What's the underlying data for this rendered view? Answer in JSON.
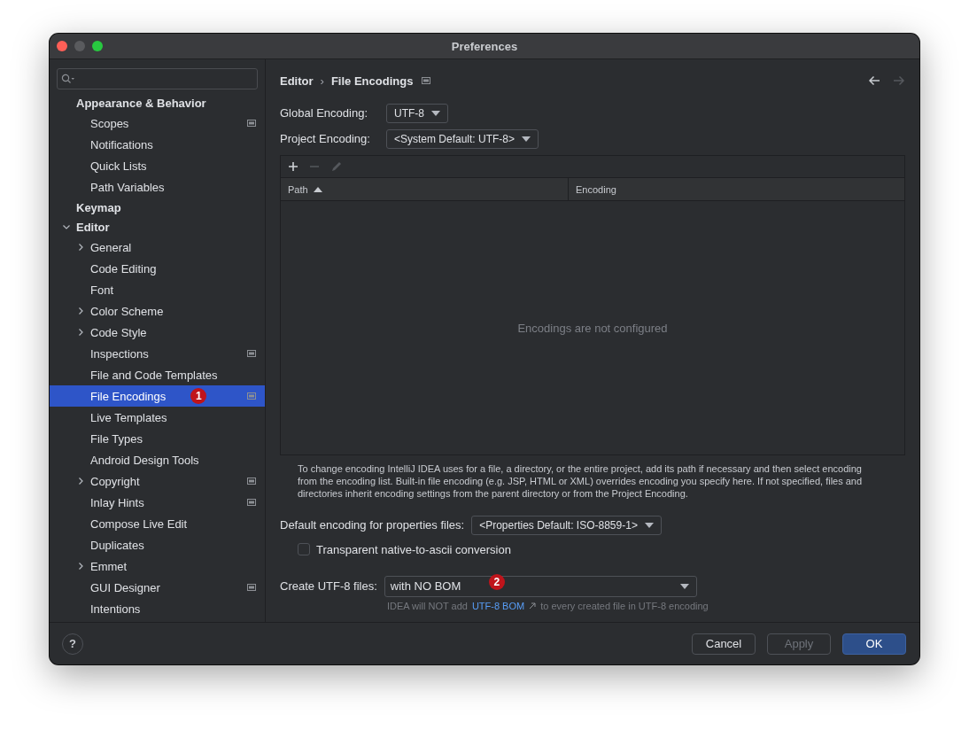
{
  "window": {
    "title": "Preferences"
  },
  "sidebar": {
    "tree": [
      {
        "label": "Appearance & Behavior",
        "kind": "group",
        "selected": false,
        "project_level": false,
        "children": [
          {
            "label": "Scopes",
            "kind": "item",
            "selected": false,
            "project_level": true
          },
          {
            "label": "Notifications",
            "kind": "item",
            "selected": false,
            "project_level": false
          },
          {
            "label": "Quick Lists",
            "kind": "item",
            "selected": false,
            "project_level": false
          },
          {
            "label": "Path Variables",
            "kind": "item",
            "selected": false,
            "project_level": false
          }
        ]
      },
      {
        "label": "Keymap",
        "kind": "group",
        "selected": false,
        "project_level": false
      },
      {
        "label": "Editor",
        "kind": "group",
        "selected": false,
        "project_level": false,
        "expanded": true,
        "children": [
          {
            "label": "General",
            "kind": "item",
            "selected": false,
            "project_level": false,
            "expanded": false
          },
          {
            "label": "Code Editing",
            "kind": "item",
            "selected": false,
            "project_level": false
          },
          {
            "label": "Font",
            "kind": "item",
            "selected": false,
            "project_level": false
          },
          {
            "label": "Color Scheme",
            "kind": "item",
            "selected": false,
            "project_level": false,
            "expanded": false
          },
          {
            "label": "Code Style",
            "kind": "item",
            "selected": false,
            "project_level": false,
            "expanded": false
          },
          {
            "label": "Inspections",
            "kind": "item",
            "selected": false,
            "project_level": true
          },
          {
            "label": "File and Code Templates",
            "kind": "item",
            "selected": false,
            "project_level": false
          },
          {
            "label": "File Encodings",
            "kind": "item",
            "selected": true,
            "project_level": true,
            "callout": "1"
          },
          {
            "label": "Live Templates",
            "kind": "item",
            "selected": false,
            "project_level": false
          },
          {
            "label": "File Types",
            "kind": "item",
            "selected": false,
            "project_level": false
          },
          {
            "label": "Android Design Tools",
            "kind": "item",
            "selected": false,
            "project_level": false
          },
          {
            "label": "Copyright",
            "kind": "item",
            "selected": false,
            "project_level": true,
            "expanded": false
          },
          {
            "label": "Inlay Hints",
            "kind": "item",
            "selected": false,
            "project_level": true
          },
          {
            "label": "Compose Live Edit",
            "kind": "item",
            "selected": false,
            "project_level": false
          },
          {
            "label": "Duplicates",
            "kind": "item",
            "selected": false,
            "project_level": false
          },
          {
            "label": "Emmet",
            "kind": "item",
            "selected": false,
            "project_level": false,
            "expanded": false
          },
          {
            "label": "GUI Designer",
            "kind": "item",
            "selected": false,
            "project_level": true
          },
          {
            "label": "Intentions",
            "kind": "item",
            "selected": false,
            "project_level": false
          }
        ]
      }
    ]
  },
  "breadcrumb": {
    "items": [
      "Editor",
      "File Encodings"
    ],
    "separator": "›",
    "project_level": true
  },
  "nav": [
    {
      "kind": "back",
      "disabled": false
    },
    {
      "kind": "forward",
      "disabled": true
    }
  ],
  "global_encoding": {
    "label": "Global Encoding:",
    "value": "UTF-8"
  },
  "project_encoding": {
    "label": "Project Encoding:",
    "value": "<System Default: UTF-8>"
  },
  "table": {
    "toolbar": [
      {
        "kind": "add",
        "disabled": false
      },
      {
        "kind": "remove",
        "disabled": true
      },
      {
        "kind": "edit",
        "disabled": true
      }
    ],
    "columns": [
      {
        "label": "Path",
        "sorted": true
      },
      {
        "label": "Encoding",
        "sorted": false
      }
    ],
    "empty_text": "Encodings are not configured"
  },
  "help_text": "To change encoding IntelliJ IDEA uses for a file, a directory, or the entire project, add its path if necessary and then select encoding from the encoding list. Built-in file encoding (e.g. JSP, HTML or XML) overrides encoding you specify here. If not specified, files and directories inherit encoding settings from the parent directory or from the Project Encoding.",
  "properties_encoding": {
    "label": "Default encoding for properties files:",
    "value": "<Properties Default: ISO-8859-1>"
  },
  "transparent_conversion": {
    "label": "Transparent native-to-ascii conversion",
    "checked": false
  },
  "create_utf8": {
    "label": "Create UTF-8 files:",
    "value": "with NO BOM",
    "callout": "2"
  },
  "bom_hint": {
    "before": "IDEA will NOT add",
    "link": "UTF-8 BOM",
    "after": "to every created file in UTF-8 encoding"
  },
  "help": "?",
  "buttons": [
    {
      "label": "Cancel",
      "kind": "normal",
      "disabled": false
    },
    {
      "label": "Apply",
      "kind": "normal",
      "disabled": true
    },
    {
      "label": "OK",
      "kind": "default",
      "disabled": false
    }
  ]
}
